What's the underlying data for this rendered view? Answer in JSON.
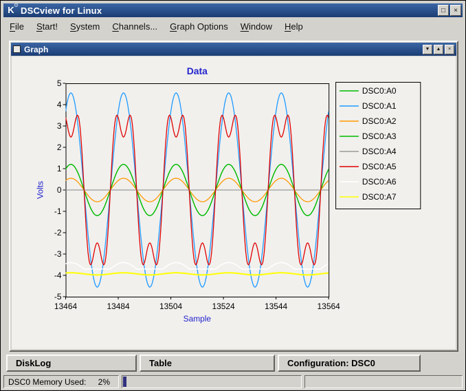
{
  "window": {
    "title": "DSCview for Linux",
    "icons": {
      "app": "K",
      "gear": "⚙",
      "maximize": "□",
      "close": "×",
      "child_minimize": "▼",
      "child_maximize": "▲"
    }
  },
  "menubar": {
    "items": [
      {
        "label": "File",
        "mnemonic": "F"
      },
      {
        "label": "Start!",
        "mnemonic": "S"
      },
      {
        "label": "System",
        "mnemonic": "S"
      },
      {
        "label": "Channels...",
        "mnemonic": "C"
      },
      {
        "label": "Graph Options",
        "mnemonic": "G"
      },
      {
        "label": "Window",
        "mnemonic": "W"
      },
      {
        "label": "Help",
        "mnemonic": "H"
      }
    ]
  },
  "graph_window": {
    "title": "Graph"
  },
  "chart_data": {
    "type": "line",
    "title": "Data",
    "xlabel": "Sample",
    "ylabel": "Volts",
    "label_color": "#2323cc",
    "xlim": [
      13464,
      13564
    ],
    "ylim": [
      -5,
      5
    ],
    "x_ticks": [
      13464,
      13484,
      13504,
      13524,
      13544,
      13564
    ],
    "y_ticks": [
      5,
      4,
      3,
      2,
      1,
      0,
      -1,
      -2,
      -3,
      -4,
      -5
    ],
    "grid": false,
    "legend_position": "right",
    "period": 20,
    "phase_ref": 13461,
    "series": [
      {
        "name": "DSC0:A0",
        "color": "#00bb00",
        "waveform": "sine",
        "amplitude": 1.2,
        "offset": 0
      },
      {
        "name": "DSC0:A1",
        "color": "#1e9aff",
        "waveform": "sine",
        "amplitude": 4.55,
        "offset": 0
      },
      {
        "name": "DSC0:A2",
        "color": "#ff9900",
        "waveform": "sine",
        "amplitude": 0.55,
        "offset": 0
      },
      {
        "name": "DSC0:A3",
        "color": "#00bb00",
        "waveform": "sine",
        "amplitude": 1.2,
        "offset": 0
      },
      {
        "name": "DSC0:A4",
        "color": "#9a9a9a",
        "waveform": "flat",
        "amplitude": 0,
        "offset": 0
      },
      {
        "name": "DSC0:A5",
        "color": "#e00000",
        "waveform": "square2",
        "amplitude": 4.1,
        "offset": 0
      },
      {
        "name": "DSC0:A6",
        "color": "#ffffff",
        "waveform": "halfwave",
        "amplitude": 0.3,
        "offset": -3.7,
        "stroke_width": 1.5
      },
      {
        "name": "DSC0:A7",
        "color": "#ffff00",
        "waveform": "sine",
        "amplitude": 0.05,
        "offset": -3.93,
        "stroke_width": 2
      }
    ]
  },
  "bottom_buttons": [
    {
      "label": "DiskLog"
    },
    {
      "label": "Table"
    },
    {
      "label": "Configuration: DSC0"
    }
  ],
  "statusbar": {
    "memory_label": "DSC0 Memory Used:",
    "memory_value": "2%",
    "memory_used_percent": 2
  }
}
